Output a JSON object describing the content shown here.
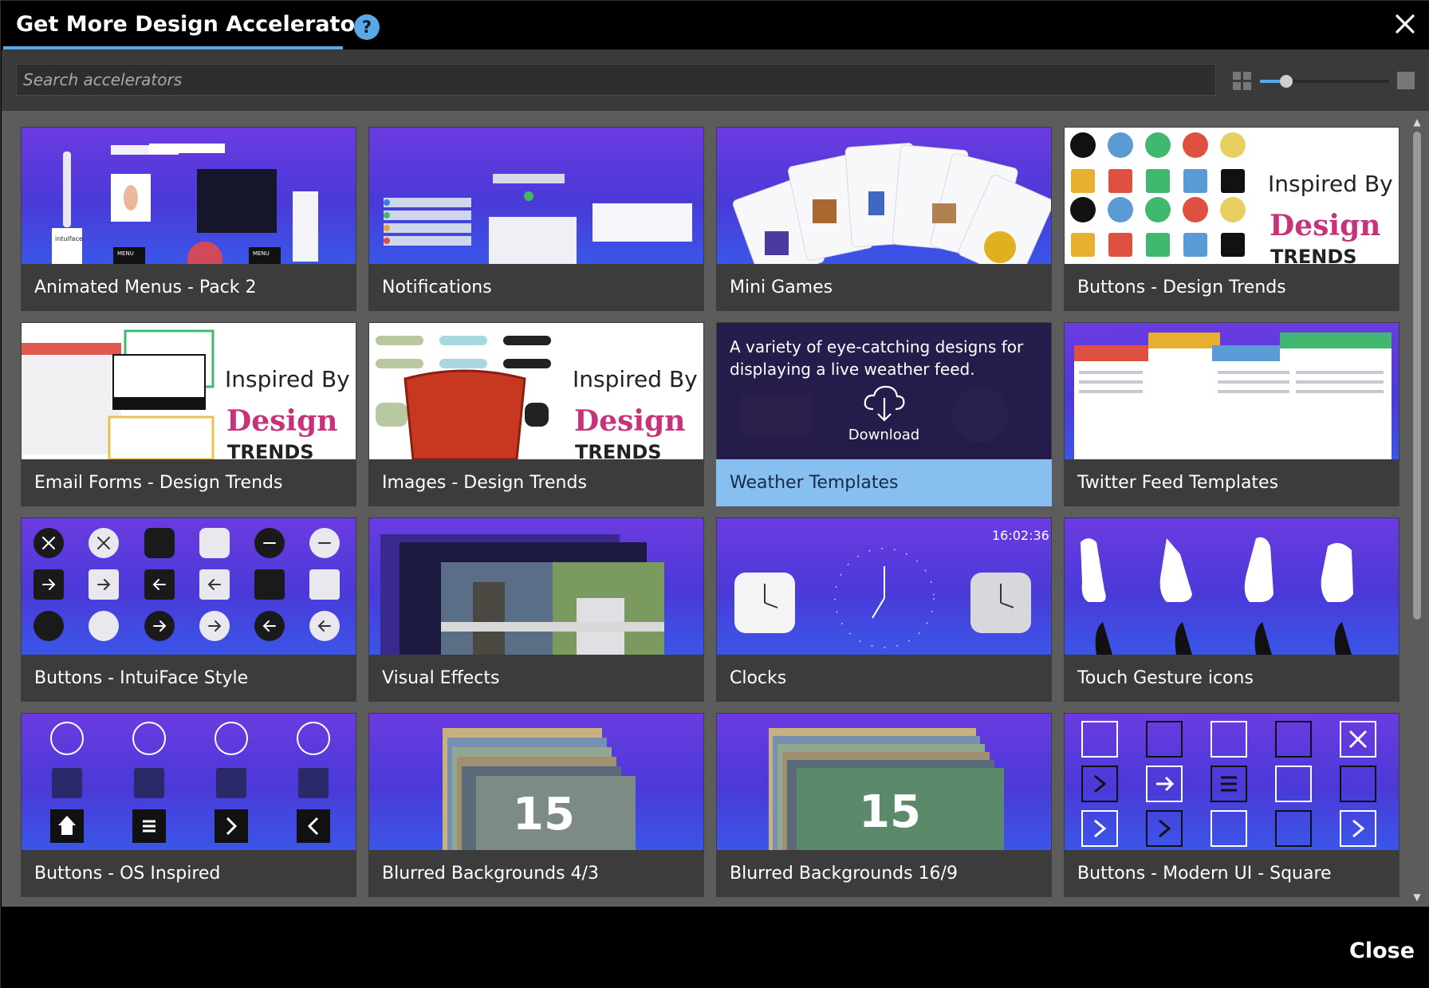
{
  "dialog": {
    "title": "Get More Design Accelerators",
    "help_label": "?",
    "close_label": "Close"
  },
  "search": {
    "placeholder": "Search accelerators"
  },
  "zoom": {
    "level": 0.17
  },
  "colors": {
    "accent": "#5aa9e6",
    "selected_caption": "#86bff0",
    "card_bg": "#3c3c3c",
    "content_bg": "#5c5c5c"
  },
  "cards": [
    {
      "label": "Animated Menus - Pack 2",
      "thumb_text": [
        "intuiface",
        "MENU",
        "MENU"
      ]
    },
    {
      "label": "Notifications"
    },
    {
      "label": "Mini Games"
    },
    {
      "label": "Buttons - Design Trends",
      "thumb_text": [
        "Inspired By",
        "Design",
        "TRENDS"
      ]
    },
    {
      "label": "Email Forms - Design Trends",
      "thumb_text": [
        "Inspired By",
        "Design",
        "TRENDS"
      ]
    },
    {
      "label": "Images - Design Trends",
      "thumb_text": [
        "Inspired By",
        "Design",
        "TRENDS"
      ]
    },
    {
      "label": "Weather Templates",
      "description": "A variety of eye-catching designs for displaying a live weather feed.",
      "action": "Download",
      "selected": true
    },
    {
      "label": "Twitter Feed Templates"
    },
    {
      "label": "Buttons - IntuiFace Style"
    },
    {
      "label": "Visual Effects"
    },
    {
      "label": "Clocks",
      "thumb_text": [
        "16:02:36"
      ]
    },
    {
      "label": "Touch Gesture icons"
    },
    {
      "label": "Buttons - OS Inspired"
    },
    {
      "label": "Blurred Backgrounds 4/3",
      "thumb_text": [
        "15"
      ]
    },
    {
      "label": "Blurred Backgrounds 16/9",
      "thumb_text": [
        "15"
      ]
    },
    {
      "label": "Buttons - Modern UI - Square"
    }
  ]
}
